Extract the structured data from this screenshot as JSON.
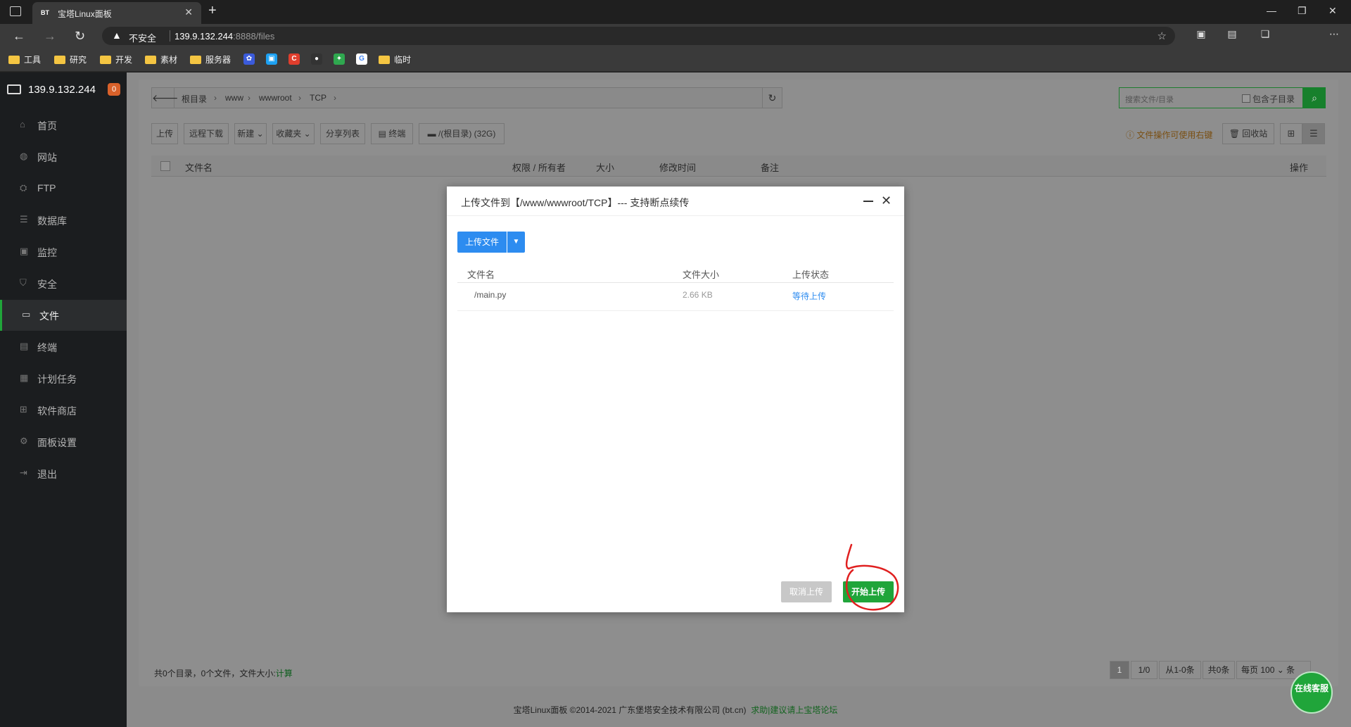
{
  "browser": {
    "tab_favicon": "BT",
    "tab_title": "宝塔Linux面板",
    "insecure_label": "不安全",
    "url_host": "139.9.132.244",
    "url_rest": ":8888/files",
    "bookmarks": [
      "工具",
      "研究",
      "开发",
      "素材",
      "服务器",
      "临时"
    ]
  },
  "sidebar": {
    "server_ip": "139.9.132.244",
    "badge_count": "0",
    "items": [
      {
        "label": "首页",
        "icon": "home-icon"
      },
      {
        "label": "网站",
        "icon": "globe-icon"
      },
      {
        "label": "FTP",
        "icon": "ftp-icon"
      },
      {
        "label": "数据库",
        "icon": "database-icon"
      },
      {
        "label": "监控",
        "icon": "monitor-icon"
      },
      {
        "label": "安全",
        "icon": "shield-icon"
      },
      {
        "label": "文件",
        "icon": "folder-icon"
      },
      {
        "label": "终端",
        "icon": "terminal-icon"
      },
      {
        "label": "计划任务",
        "icon": "calendar-icon"
      },
      {
        "label": "软件商店",
        "icon": "apps-icon"
      },
      {
        "label": "面板设置",
        "icon": "gear-icon"
      },
      {
        "label": "退出",
        "icon": "logout-icon"
      }
    ],
    "active_item": "文件"
  },
  "breadcrumb": [
    "根目录",
    "www",
    "wwwroot",
    "TCP"
  ],
  "search": {
    "placeholder": "搜索文件/目录",
    "include_subdir": "包含子目录"
  },
  "toolbar": {
    "upload": "上传",
    "remote_download": "远程下载",
    "new": "新建",
    "favorites": "收藏夹",
    "share_list": "分享列表",
    "terminal": "终端",
    "disk": "/(根目录) (32G)",
    "tip": "文件操作可使用右键",
    "recycle": "回收站"
  },
  "table_headers": [
    "文件名",
    "权限 / 所有者",
    "大小",
    "修改时间",
    "备注",
    "操作"
  ],
  "summary": {
    "text": "共0个目录，0个文件，文件大小:",
    "calc": "计算"
  },
  "pager": {
    "current": "1",
    "pages": "1/0",
    "range": "从1-0条",
    "total": "共0条",
    "per_page_label": "每页",
    "per_page": "100",
    "unit": "条"
  },
  "footer": {
    "copyright": "宝塔Linux面板 ©2014-2021 广东堡塔安全技术有限公司 (bt.cn)",
    "link": "求助|建议请上宝塔论坛"
  },
  "chat_button": "在线客服",
  "dialog": {
    "title": "上传文件到【/www/wwwroot/TCP】--- 支持断点续传",
    "upload_btn": "上传文件",
    "headers": [
      "文件名",
      "文件大小",
      "上传状态"
    ],
    "files": [
      {
        "name": "/main.py",
        "size": "2.66 KB",
        "status": "等待上传"
      }
    ],
    "cancel": "取消上传",
    "start": "开始上传"
  },
  "colors": {
    "accent_green": "#20a53a",
    "upload_blue": "#2d8cf0",
    "annotation_red": "#e02020"
  }
}
